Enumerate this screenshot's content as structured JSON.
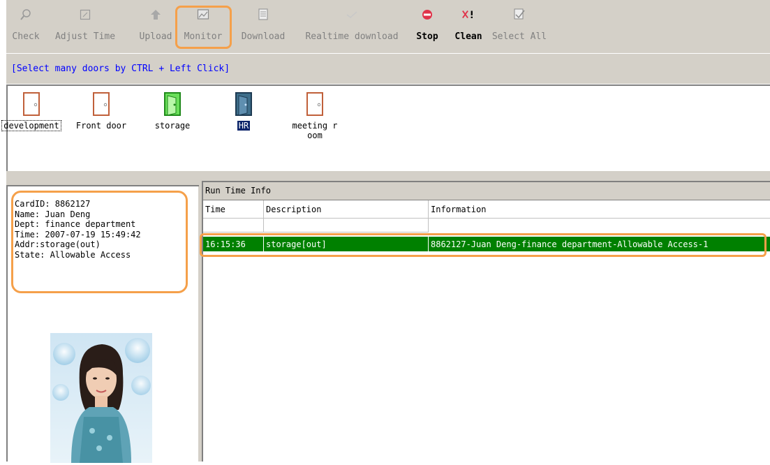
{
  "toolbar": {
    "check_label": "Check",
    "adjust_time_label": "Adjust Time",
    "upload_label": "Upload",
    "monitor_label": "Monitor",
    "download_label": "Download",
    "realtime_download_label": "Realtime download",
    "stop_label": "Stop",
    "clean_label": "Clean",
    "select_all_label": "Select All"
  },
  "hint": "[Select many doors by CTRL + Left Click]",
  "doors": [
    {
      "label": "development",
      "state": "closed",
      "focused": true
    },
    {
      "label": "Front door",
      "state": "closed"
    },
    {
      "label": "storage",
      "state": "open"
    },
    {
      "label": "HR",
      "state": "closed-selected",
      "selected": true
    },
    {
      "label": "meeting room",
      "state": "closed"
    }
  ],
  "card_info": {
    "card_id": "CardID: 8862127",
    "name": "Name: Juan Deng",
    "dept": "Dept: finance department",
    "time": "Time: 2007-07-19 15:49:42",
    "addr": "Addr:storage(out)",
    "state": "State: Allowable Access"
  },
  "runtime": {
    "title": "Run Time Info",
    "columns": [
      "Time",
      "Description",
      "Information"
    ],
    "rows": [
      {
        "time": "",
        "description": "",
        "information": ""
      },
      {
        "time": "16:15:36",
        "description": "storage[out]",
        "information": "8862127-Juan Deng-finance department-Allowable Access-1"
      }
    ]
  },
  "colors": {
    "highlight": "#f5a04a",
    "selected_row": "#008000",
    "hint_text": "#0000ff",
    "chrome": "#d4d0c8"
  },
  "icons": {
    "check": "magnifier-icon",
    "adjust_time": "clock-icon",
    "upload": "upload-icon",
    "monitor": "monitor-icon",
    "download": "download-icon",
    "realtime_download": "realtime-download-icon",
    "stop": "stop-icon",
    "clean": "clean-icon",
    "select_all": "select-all-icon"
  }
}
